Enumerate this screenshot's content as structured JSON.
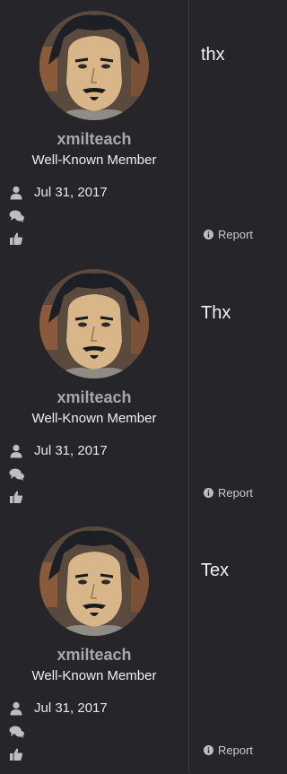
{
  "posts": [
    {
      "username": "xmilteach",
      "user_title": "Well-Known Member",
      "join_date": "Jul 31, 2017",
      "message": "thx",
      "report_label": "Report"
    },
    {
      "username": "xmilteach",
      "user_title": "Well-Known Member",
      "join_date": "Jul 31, 2017",
      "message": "Thx",
      "report_label": "Report"
    },
    {
      "username": "xmilteach",
      "user_title": "Well-Known Member",
      "join_date": "Jul 31, 2017",
      "message": "Tex",
      "report_label": "Report"
    }
  ],
  "icons": {
    "joined": "user-icon",
    "messages": "chat-bubbles-icon",
    "reactions": "thumbs-up-icon",
    "report": "info-circle-icon"
  },
  "colors": {
    "background": "#25252a",
    "username": "#a7a7b0",
    "divider": "#3a3a40"
  }
}
